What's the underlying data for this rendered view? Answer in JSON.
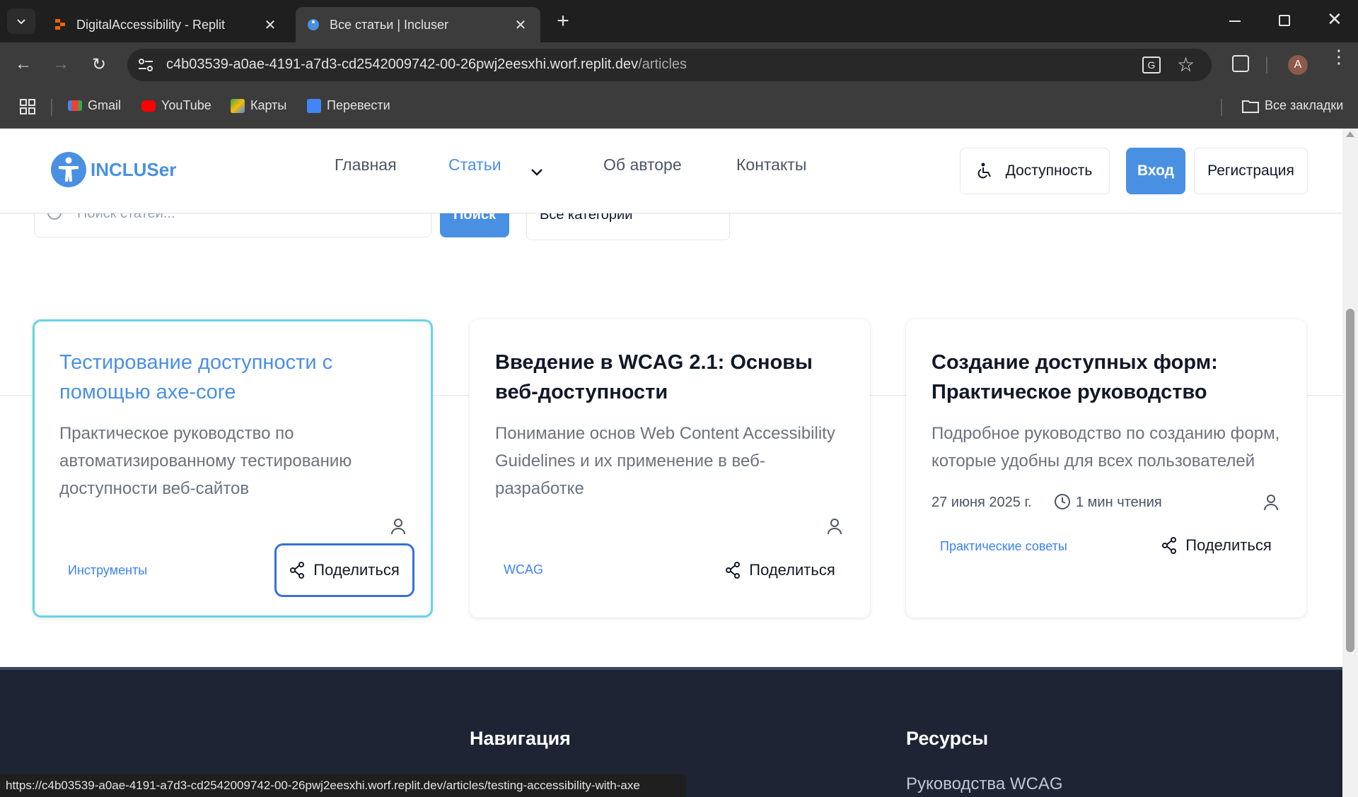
{
  "browser": {
    "tabs": [
      {
        "title": "DigitalAccessibility - Replit",
        "active": false
      },
      {
        "title": "Все статьи | Incluser",
        "active": true
      }
    ],
    "new_tab_label": "+",
    "url_host": "c4b03539-a0ae-4191-a7d3-cd2542009742-00-26pwj2eesxhi.worf.replit.dev",
    "url_path": "/articles",
    "profile_initial": "A",
    "bookmarks": [
      "Gmail",
      "YouTube",
      "Карты",
      "Перевести"
    ],
    "all_bookmarks": "Все закладки",
    "status_url": "https://c4b03539-a0ae-4191-a7d3-cd2542009742-00-26pwj2eesxhi.worf.replit.dev/articles/testing-accessibility-with-axe"
  },
  "site": {
    "logo_text": "INCLUSer",
    "nav": {
      "home": "Главная",
      "articles": "Статьи",
      "about": "Об авторе",
      "contacts": "Контакты"
    },
    "accessibility_button": "Доступность",
    "login_button": "Вход",
    "register_button": "Регистрация",
    "search_placeholder": "Поиск статей...",
    "search_button": "Поиск",
    "category_select": "Все категории",
    "accent_color": "#4a90e2"
  },
  "articles": [
    {
      "title": "Тестирование доступности с помощью axe-core",
      "description": "Практическое руководство по автоматизированному тестированию доступности веб-сайтов",
      "category": "Инструменты",
      "share": "Поделиться"
    },
    {
      "title": "Введение в WCAG 2.1: Основы веб-доступности",
      "description": "Понимание основ Web Content Accessibility Guidelines и их применение в веб-разработке",
      "category": "WCAG",
      "share": "Поделиться"
    },
    {
      "title": "Создание доступных форм: Практическое руководство",
      "description": "Подробное руководство по созданию форм, которые удобны для всех пользователей",
      "date": "27 июня 2025 г.",
      "read_time": "1 мин чтения",
      "category": "Практические советы",
      "share": "Поделиться"
    }
  ],
  "footer": {
    "nav_heading": "Навигация",
    "resources_heading": "Ресурсы",
    "resources_first_link": "Руководства WCAG"
  }
}
